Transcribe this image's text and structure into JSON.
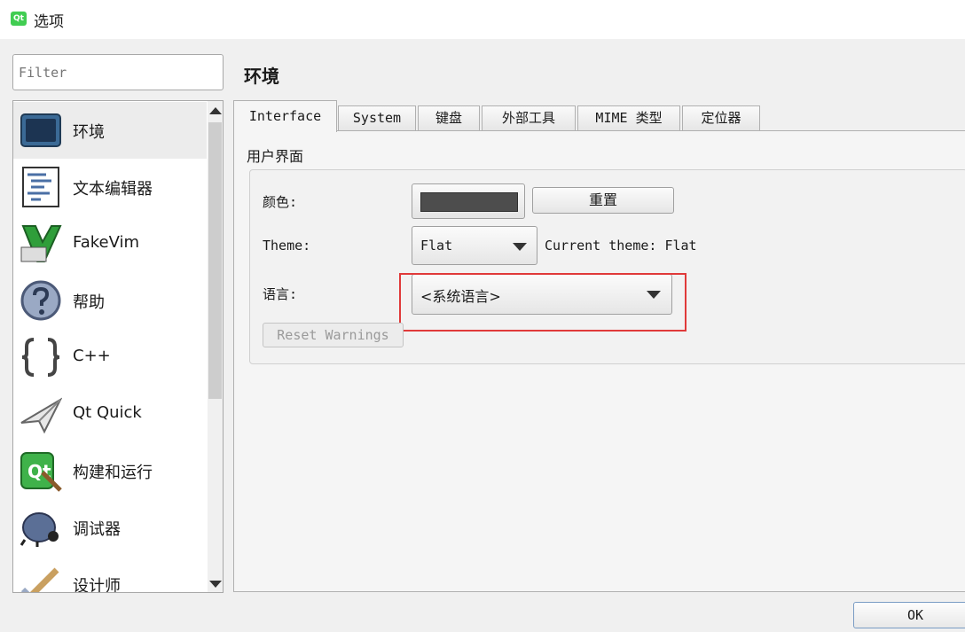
{
  "window": {
    "title": "选项",
    "app_icon_text": "Qt"
  },
  "filter": {
    "placeholder": "Filter",
    "value": ""
  },
  "categories": [
    {
      "label": "环境",
      "icon": "monitor-icon",
      "selected": true
    },
    {
      "label": "文本编辑器",
      "icon": "text-editor-icon",
      "selected": false
    },
    {
      "label": "FakeVim",
      "icon": "fakevim-icon",
      "selected": false
    },
    {
      "label": "帮助",
      "icon": "help-icon",
      "selected": false
    },
    {
      "label": "C++",
      "icon": "cpp-braces-icon",
      "selected": false
    },
    {
      "label": "Qt Quick",
      "icon": "paper-plane-icon",
      "selected": false
    },
    {
      "label": "构建和运行",
      "icon": "build-run-icon",
      "selected": false
    },
    {
      "label": "调试器",
      "icon": "bug-icon",
      "selected": false
    },
    {
      "label": "设计师",
      "icon": "designer-icon",
      "selected": false
    }
  ],
  "page": {
    "title": "环境"
  },
  "tabs": [
    {
      "label": "Interface",
      "active": true
    },
    {
      "label": "System",
      "active": false
    },
    {
      "label": "键盘",
      "active": false
    },
    {
      "label": "外部工具",
      "active": false
    },
    {
      "label": "MIME 类型",
      "active": false
    },
    {
      "label": "定位器",
      "active": false
    }
  ],
  "interface": {
    "group_title": "用户界面",
    "color_label": "颜色:",
    "color_value": "#4d4d4d",
    "reset_label": "重置",
    "theme_label": "Theme:",
    "theme_value": "Flat",
    "current_theme_text": "Current theme: Flat",
    "language_label": "语言:",
    "language_value": "<系统语言>",
    "reset_warnings_label": "Reset Warnings"
  },
  "footer": {
    "ok_label": "OK"
  },
  "colors": {
    "highlight_border": "#e03a3a",
    "accent": "#41cd52"
  }
}
